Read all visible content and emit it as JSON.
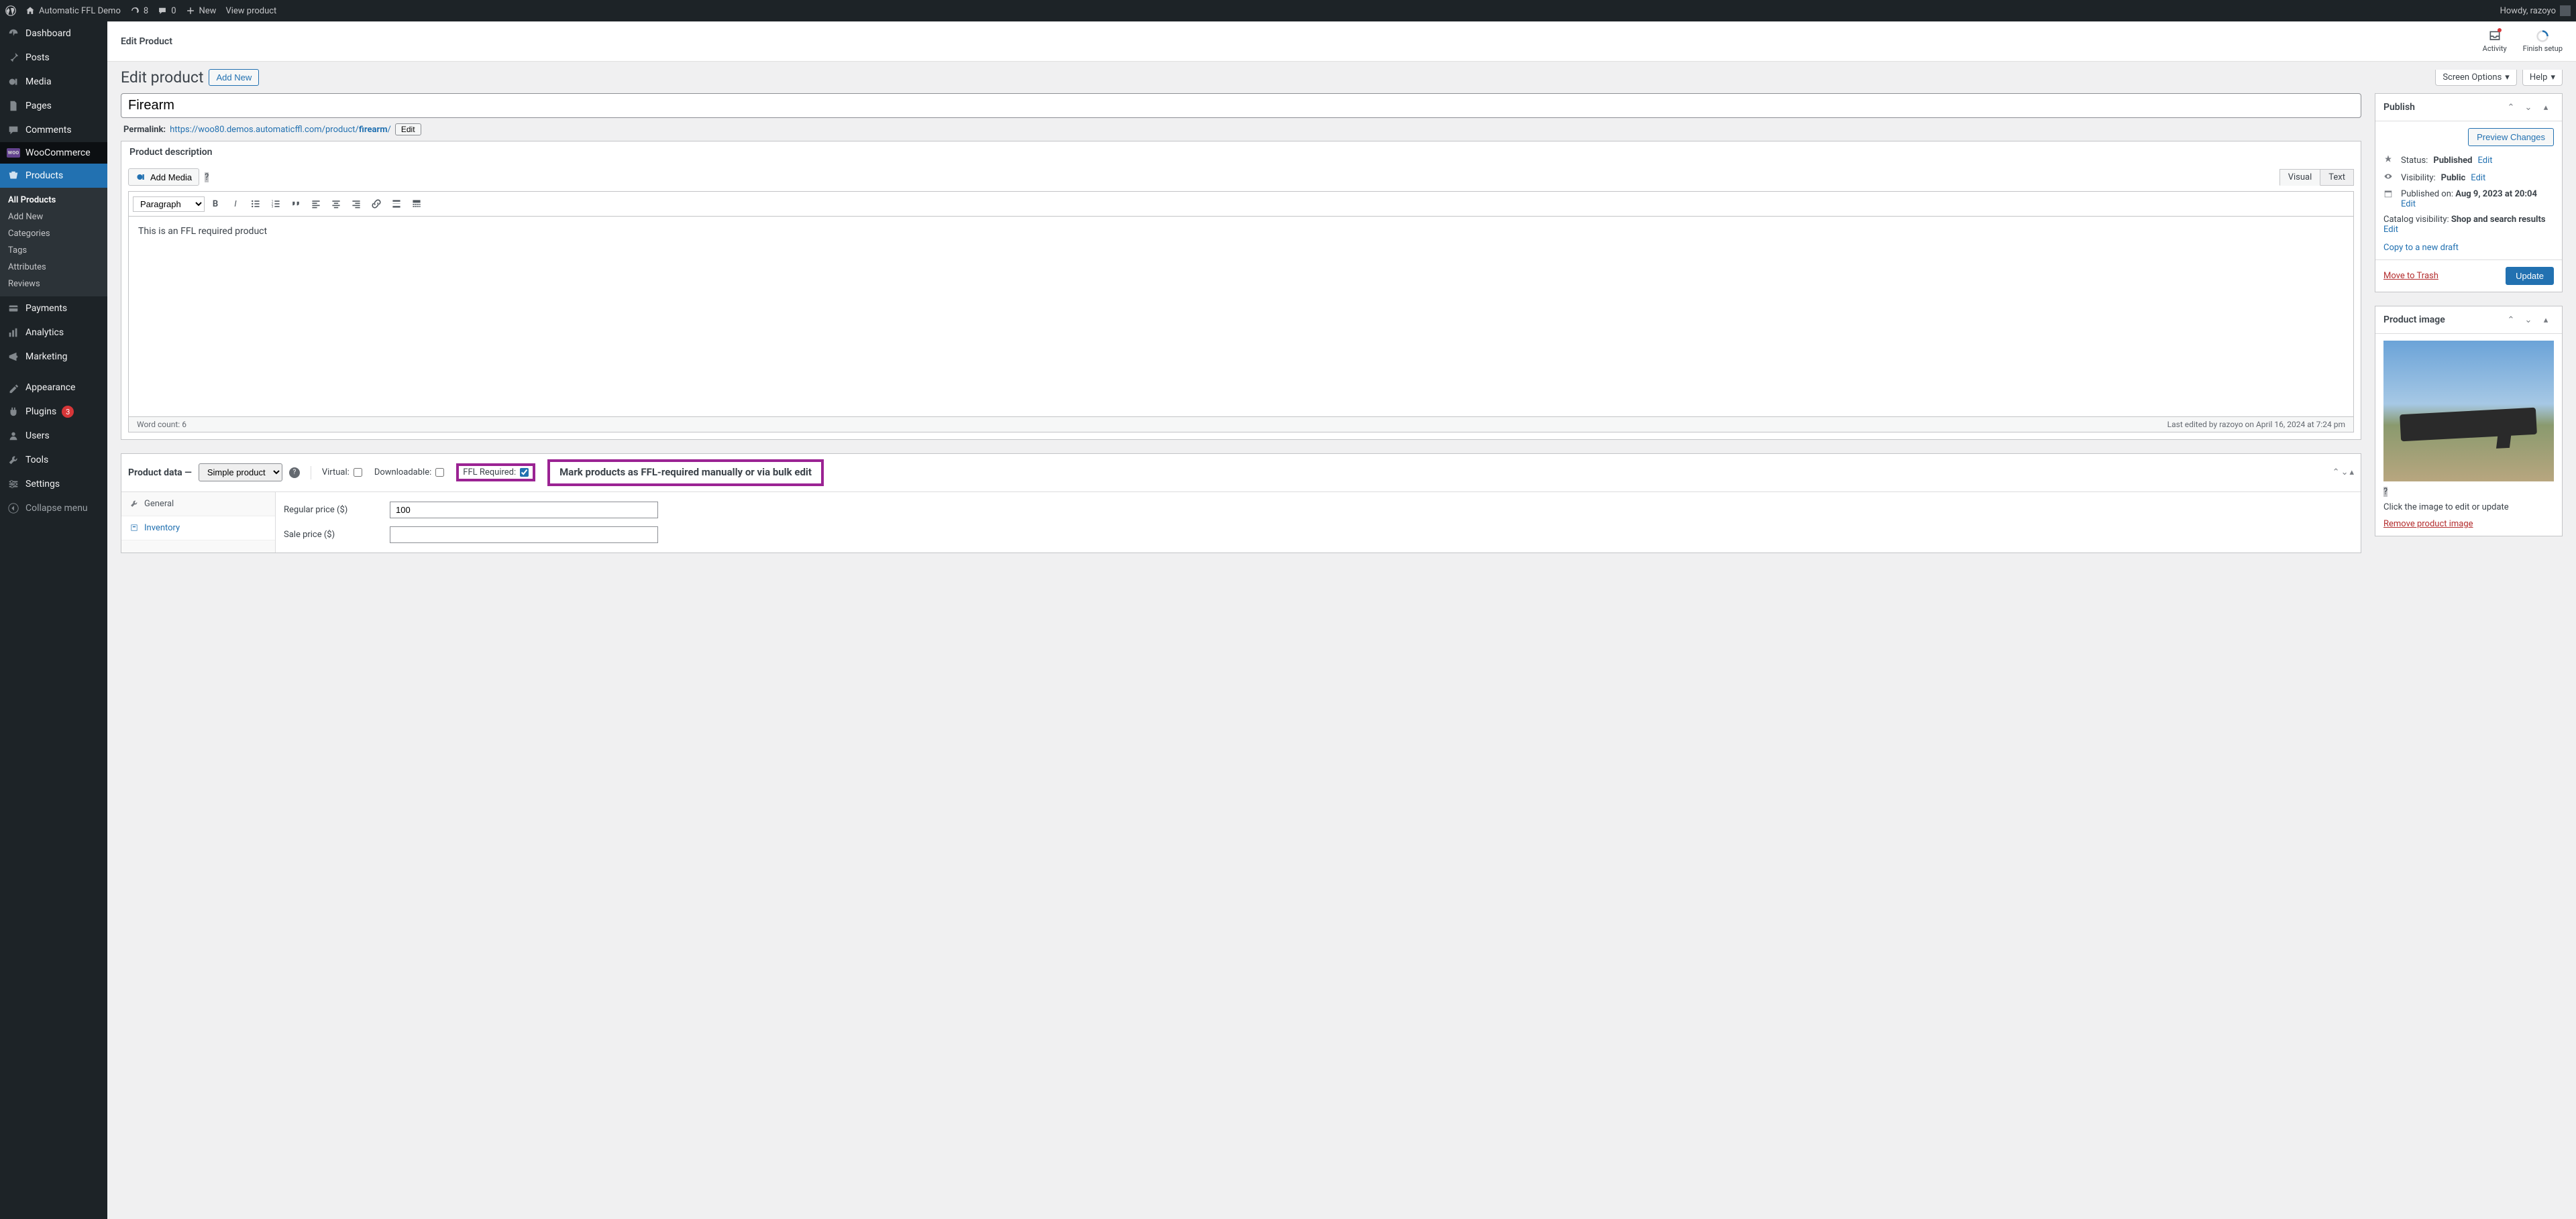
{
  "adminbar": {
    "site_name": "Automatic FFL Demo",
    "updates": "8",
    "comments": "0",
    "new_label": "New",
    "view_product": "View product",
    "howdy": "Howdy, razoyo"
  },
  "sidebar": {
    "dashboard": "Dashboard",
    "posts": "Posts",
    "media": "Media",
    "pages": "Pages",
    "comments": "Comments",
    "woocommerce": "WooCommerce",
    "products": "Products",
    "products_sub": {
      "all_products": "All Products",
      "add_new": "Add New",
      "categories": "Categories",
      "tags": "Tags",
      "attributes": "Attributes",
      "reviews": "Reviews"
    },
    "payments": "Payments",
    "analytics": "Analytics",
    "marketing": "Marketing",
    "appearance": "Appearance",
    "plugins": "Plugins",
    "plugins_count": "3",
    "users": "Users",
    "tools": "Tools",
    "settings": "Settings",
    "collapse": "Collapse menu"
  },
  "wc_header": {
    "title": "Edit Product",
    "activity": "Activity",
    "finish_setup": "Finish setup"
  },
  "screen_options": "Screen Options",
  "help": "Help",
  "page_title": "Edit product",
  "add_new_btn": "Add New",
  "product_title": "Firearm",
  "permalink": {
    "label": "Permalink:",
    "url_base": "https://woo80.demos.automaticffl.com/product/",
    "slug": "firearm",
    "url_suffix": "/",
    "edit": "Edit"
  },
  "editor": {
    "section_title": "Product description",
    "add_media": "Add Media",
    "tab_visual": "Visual",
    "tab_text": "Text",
    "paragraph": "Paragraph",
    "content": "This is an FFL required product",
    "word_count_label": "Word count: ",
    "word_count": "6",
    "last_edit": "Last edited by razoyo on April 16, 2024 at 7:24 pm"
  },
  "product_data": {
    "header": "Product data",
    "dash": " — ",
    "type": "Simple product",
    "virtual": "Virtual:",
    "downloadable": "Downloadable:",
    "ffl_required": "FFL Required:",
    "callout": "Mark products as FFL-required manually or via bulk edit",
    "tabs": {
      "general": "General",
      "inventory": "Inventory"
    },
    "regular_price_label": "Regular price ($)",
    "regular_price": "100",
    "sale_price_label": "Sale price ($)",
    "sale_price": ""
  },
  "publish": {
    "title": "Publish",
    "preview": "Preview Changes",
    "status_label": "Status:",
    "status_value": "Published",
    "edit": "Edit",
    "visibility_label": "Visibility:",
    "visibility_value": "Public",
    "published_on_label": "Published on:",
    "published_on_value": "Aug 9, 2023 at 20:04",
    "catalog_label": "Catalog visibility:",
    "catalog_value": "Shop and search results",
    "copy_draft": "Copy to a new draft",
    "move_trash": "Move to Trash",
    "update": "Update"
  },
  "product_image": {
    "title": "Product image",
    "hint": "Click the image to edit or update",
    "remove": "Remove product image"
  }
}
